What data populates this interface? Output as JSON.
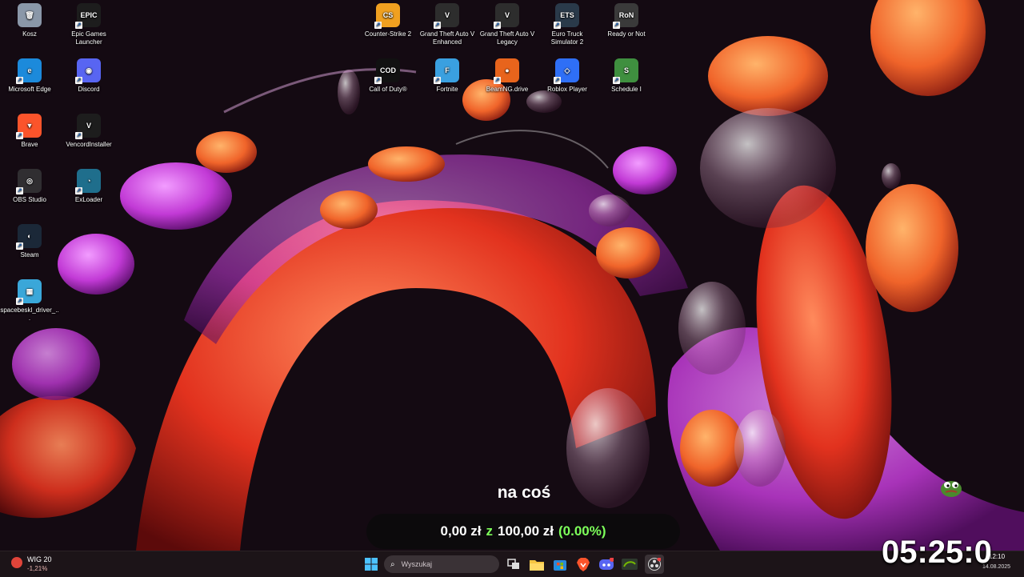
{
  "desktop": {
    "icons": [
      {
        "label": "Kosz",
        "icon": "recycle-bin-icon",
        "color": "#8a97a8",
        "glyph": "🗑"
      },
      {
        "label": "Epic Games Launcher",
        "icon": "epic-games-icon",
        "color": "#1d1d1d",
        "glyph": "EPIC"
      },
      {
        "label": "Microsoft Edge",
        "icon": "edge-icon",
        "color": "#1c8adb",
        "glyph": "e"
      },
      {
        "label": "Discord",
        "icon": "discord-icon",
        "color": "#5865f2",
        "glyph": "◉"
      },
      {
        "label": "Brave",
        "icon": "brave-icon",
        "color": "#fb542b",
        "glyph": "▼"
      },
      {
        "label": "VencordInstaller",
        "icon": "vencord-icon",
        "color": "#1d1d1d",
        "glyph": "V"
      },
      {
        "label": "OBS Studio",
        "icon": "obs-icon",
        "color": "#302e31",
        "glyph": "◎"
      },
      {
        "label": "ExLoader",
        "icon": "exloader-icon",
        "color": "#1f6e8c",
        "glyph": "◔"
      },
      {
        "label": "Steam",
        "icon": "steam-icon",
        "color": "#1b2838",
        "glyph": "◐"
      },
      {
        "label": "spacebeskl_driver_...",
        "icon": "driver-installer-icon",
        "color": "#3aa7d9",
        "glyph": "▦"
      },
      {
        "label": "Counter-Strike 2",
        "icon": "counter-strike-icon",
        "color": "#f0a020",
        "glyph": "CS"
      },
      {
        "label": "Grand Theft Auto V Enhanced",
        "icon": "gta-v-icon",
        "color": "#2d2d2d",
        "glyph": "V"
      },
      {
        "label": "Grand Theft Auto V Legacy",
        "icon": "gta-v-legacy-icon",
        "color": "#2d2d2d",
        "glyph": "V"
      },
      {
        "label": "Euro Truck Simulator 2",
        "icon": "euro-truck-icon",
        "color": "#2a3a4a",
        "glyph": "ETS"
      },
      {
        "label": "Ready or Not",
        "icon": "ready-or-not-icon",
        "color": "#3a3a3a",
        "glyph": "RoN"
      },
      {
        "label": "Call of Duty®",
        "icon": "call-of-duty-icon",
        "color": "#111111",
        "glyph": "COD"
      },
      {
        "label": "Fortnite",
        "icon": "fortnite-icon",
        "color": "#3aa0e0",
        "glyph": "F"
      },
      {
        "label": "BeamNG.drive",
        "icon": "beamng-icon",
        "color": "#e8641c",
        "glyph": "●"
      },
      {
        "label": "Roblox Player",
        "icon": "roblox-icon",
        "color": "#2f6ff6",
        "glyph": "◇"
      },
      {
        "label": "Schedule I",
        "icon": "schedule-i-icon",
        "color": "#3f8f3f",
        "glyph": "S"
      }
    ]
  },
  "overlay": {
    "title": "na coś",
    "current": "0,00 zł",
    "separator": "z",
    "goal": "100,00 zł",
    "percent": "(0.00%)",
    "progress_fraction": 0.0
  },
  "taskbar": {
    "widget": {
      "name": "WIG 20",
      "value": "-1,21%"
    },
    "search_placeholder": "Wyszukaj",
    "pinned": [
      {
        "icon": "windows-start-icon"
      },
      {
        "icon": "task-view-icon"
      },
      {
        "icon": "file-explorer-icon"
      },
      {
        "icon": "microsoft-store-icon"
      },
      {
        "icon": "brave-icon"
      },
      {
        "icon": "discord-icon"
      },
      {
        "icon": "nvidia-icon"
      },
      {
        "icon": "obs-icon"
      }
    ],
    "tray_time": "12:10",
    "tray_date": "14.08.2025"
  },
  "clock_overlay": "05:25:0",
  "accent_colors": {
    "wallpaper_orange": "#ff6a1a",
    "wallpaper_magenta": "#c23ad6",
    "progress_green": "#7dff5a"
  }
}
